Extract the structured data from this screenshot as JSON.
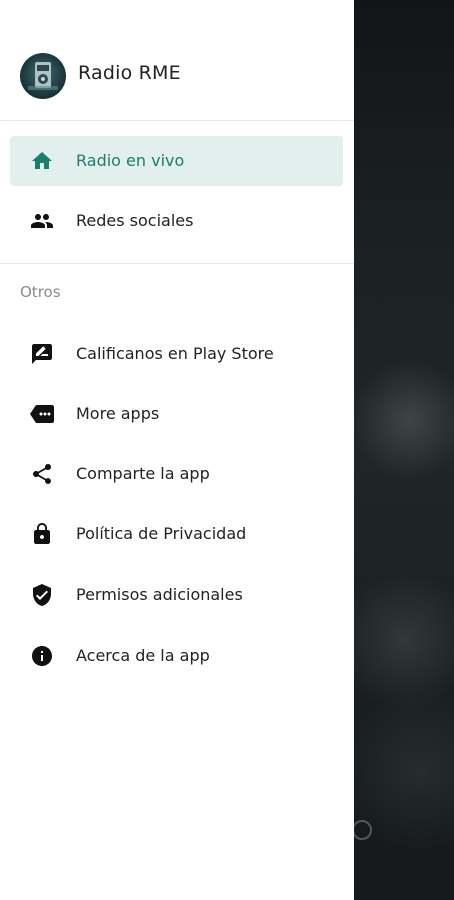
{
  "app": {
    "title": "Radio RME"
  },
  "primary_items": [
    {
      "label": "Radio en vivo",
      "icon": "home-icon",
      "active": true
    },
    {
      "label": "Redes sociales",
      "icon": "people-icon",
      "active": false
    }
  ],
  "section": {
    "label": "Otros"
  },
  "other_items": [
    {
      "label": "Calificanos en Play Store",
      "icon": "rate-review-icon"
    },
    {
      "label": "More apps",
      "icon": "more-apps-icon"
    },
    {
      "label": "Comparte la app",
      "icon": "share-icon"
    },
    {
      "label": "Política de Privacidad",
      "icon": "lock-icon"
    },
    {
      "label": "Permisos adicionales",
      "icon": "shield-check-icon"
    },
    {
      "label": "Acerca de la app",
      "icon": "info-icon"
    }
  ],
  "colors": {
    "accent": "#1a7f6a",
    "active_background": "#e3efec",
    "icon": "#111111"
  }
}
